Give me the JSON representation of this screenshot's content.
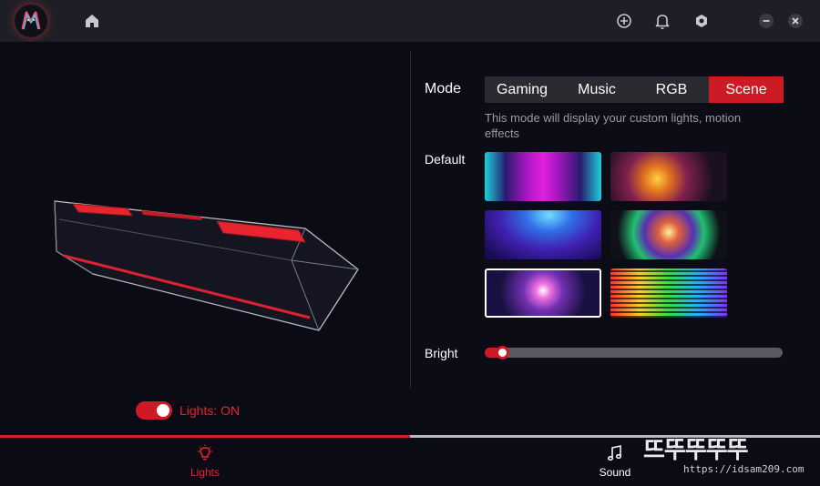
{
  "titlebar": {
    "icons": [
      "app-logo",
      "home-icon",
      "add-icon",
      "bell-icon",
      "settings-icon",
      "minimize-icon",
      "close-icon"
    ]
  },
  "lights": {
    "toggle_on": true,
    "status_label": "Lights: ON"
  },
  "mode": {
    "label": "Mode",
    "tabs": [
      {
        "label": "Gaming",
        "active": false
      },
      {
        "label": "Music",
        "active": false
      },
      {
        "label": "RGB",
        "active": false
      },
      {
        "label": "Scene",
        "active": true
      }
    ],
    "description": "This mode will display your custom lights, motion effects"
  },
  "default": {
    "label": "Default",
    "selected_index": 4,
    "thumbnails": [
      "scene-neon-bars",
      "scene-bokeh-warm",
      "scene-blue-rays",
      "scene-bokeh-burst",
      "scene-pink-sparkle",
      "scene-equalizer"
    ]
  },
  "bright": {
    "label": "Bright",
    "value_fraction": 0.05
  },
  "bottom_nav": {
    "lights_label": "Lights",
    "sound_label": "Sound",
    "active": "Lights"
  },
  "watermark": {
    "title": "뜨뚜뚜뚜뚜",
    "url": "https://idsam209.com"
  },
  "colors": {
    "accent": "#cc1b24",
    "titlebar": "#1e1f26",
    "background": "#0b0c16"
  }
}
